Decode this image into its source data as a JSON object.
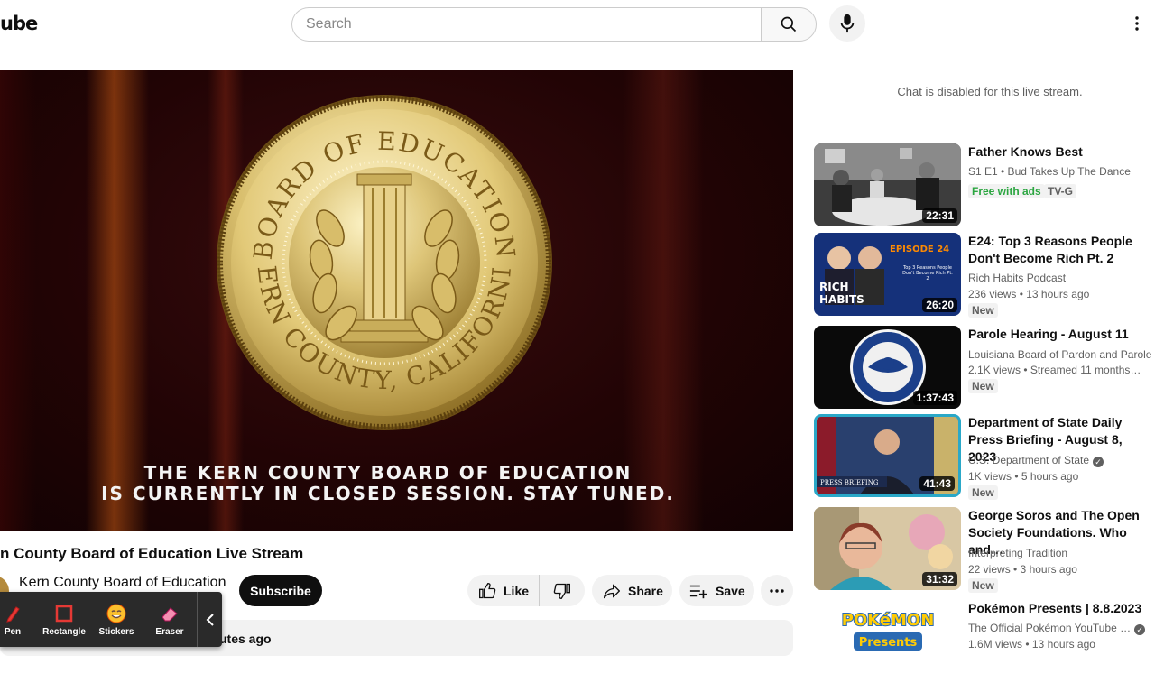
{
  "header": {
    "logo_text": "ube",
    "search_placeholder": "Search",
    "icons": [
      "search-icon",
      "mic-icon",
      "kebab-menu-icon"
    ]
  },
  "player": {
    "seal_top_text": "BOARD OF EDUCATION",
    "seal_bottom_text": "KERN COUNTY, CALIFORNIA",
    "banner_line1": "THE KERN COUNTY BOARD OF EDUCATION",
    "banner_line2": "IS CURRENTLY IN CLOSED SESSION.  STAY TUNED."
  },
  "video": {
    "title": "n County Board of Education Live Stream",
    "channel": "Kern County Board of Education",
    "subscribe_label": "Subscribe",
    "like_label": "Like",
    "share_label": "Share",
    "save_label": "Save",
    "description_time": "utes ago"
  },
  "annotation_toolbar": {
    "pen": "Pen",
    "rectangle": "Rectangle",
    "stickers": "Stickers",
    "eraser": "Eraser"
  },
  "chat": {
    "disabled_text": "Chat is disabled for this live stream."
  },
  "recommendations": [
    {
      "title": "Father Knows Best",
      "meta1": "S1 E1 • Bud Takes Up The Dance",
      "free_label": "Free with ads",
      "rating": "TV-G",
      "duration": "22:31"
    },
    {
      "title": "E24: Top 3 Reasons People Don't Become Rich Pt. 2",
      "channel": "Rich Habits Podcast",
      "stats": "236 views • 13 hours ago",
      "badge": "New",
      "duration": "26:20",
      "thumb_episode": "EPISODE 24",
      "thumb_brand_1": "RICH",
      "thumb_brand_2": "HABITS",
      "thumb_caption": "Top 3 Reasons People Don't Become Rich Pt. 2"
    },
    {
      "title": "Parole Hearing - August 11",
      "channel": "Louisiana Board of Pardon and Parole",
      "stats": "2.1K views • Streamed 11 months…",
      "badge": "New",
      "duration": "1:37:43"
    },
    {
      "title": "Department of State Daily Press Briefing - August 8, 2023",
      "channel": "U.S. Department of State",
      "stats": "1K views • 5 hours ago",
      "badge": "New",
      "duration": "41:43",
      "thumb_caption": "PRESS BRIEFING"
    },
    {
      "title": "George Soros and The Open Society Foundations. Who and…",
      "channel": "Interpreting Tradition",
      "stats": "22 views • 3 hours ago",
      "badge": "New",
      "duration": "31:32"
    },
    {
      "title": "Pokémon Presents | 8.8.2023",
      "channel": "The Official Pokémon YouTube …",
      "stats": "1.6M views • 13 hours ago",
      "thumb_logo": "POKéMON",
      "thumb_logo_2": "Presents"
    }
  ]
}
